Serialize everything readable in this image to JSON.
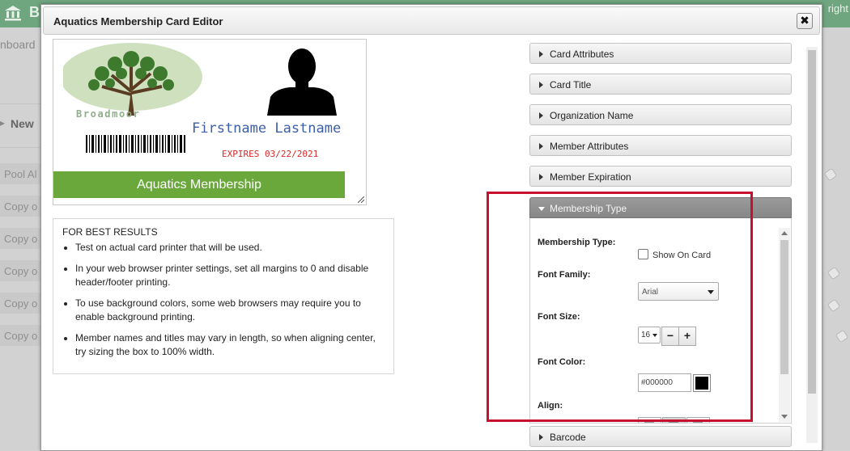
{
  "app": {
    "name": "B",
    "right_text": "right",
    "dashboard_label": "nboard",
    "new_label": "New",
    "rows": [
      "Pool Al",
      "Copy o",
      "Copy o",
      "Copy o",
      "Copy o",
      "Copy o"
    ]
  },
  "modal": {
    "title": "Aquatics Membership Card Editor",
    "close_label": "✖"
  },
  "card": {
    "logo_text": "Broadmoor",
    "member_name": "Firstname Lastname",
    "expires": "EXPIRES 03/22/2021",
    "banner": "Aquatics Membership",
    "banner_color": "#6aa83b"
  },
  "tips": {
    "title": "FOR BEST RESULTS",
    "items": [
      "Test on actual card printer that will be used.",
      "In your web browser printer settings, set all margins to 0 and disable header/footer printing.",
      "To use background colors, some web browsers may require you to enable background printing.",
      "Member names and titles may vary in length, so when aligning center, try sizing the box to 100% width."
    ]
  },
  "accordion": {
    "sections": [
      "Card Attributes",
      "Card Title",
      "Organization Name",
      "Member Attributes",
      "Member Expiration",
      "Membership Type",
      "Barcode"
    ],
    "open_section": "Membership Type"
  },
  "membership_type_panel": {
    "membership_type_label": "Membership Type:",
    "show_on_card_label": "Show On Card",
    "show_on_card_checked": false,
    "font_family_label": "Font Family:",
    "font_family_value": "Arial",
    "font_size_label": "Font Size:",
    "font_size_value": "16",
    "minus_label": "−",
    "plus_label": "+",
    "font_color_label": "Font Color:",
    "font_color_value": "#000000",
    "align_label": "Align:",
    "align_selected": "center"
  },
  "colors": {
    "header_green": "#6fa57f",
    "highlight": "#c8102e",
    "name_blue": "#3d5fa8",
    "expires_red": "#d62828"
  }
}
